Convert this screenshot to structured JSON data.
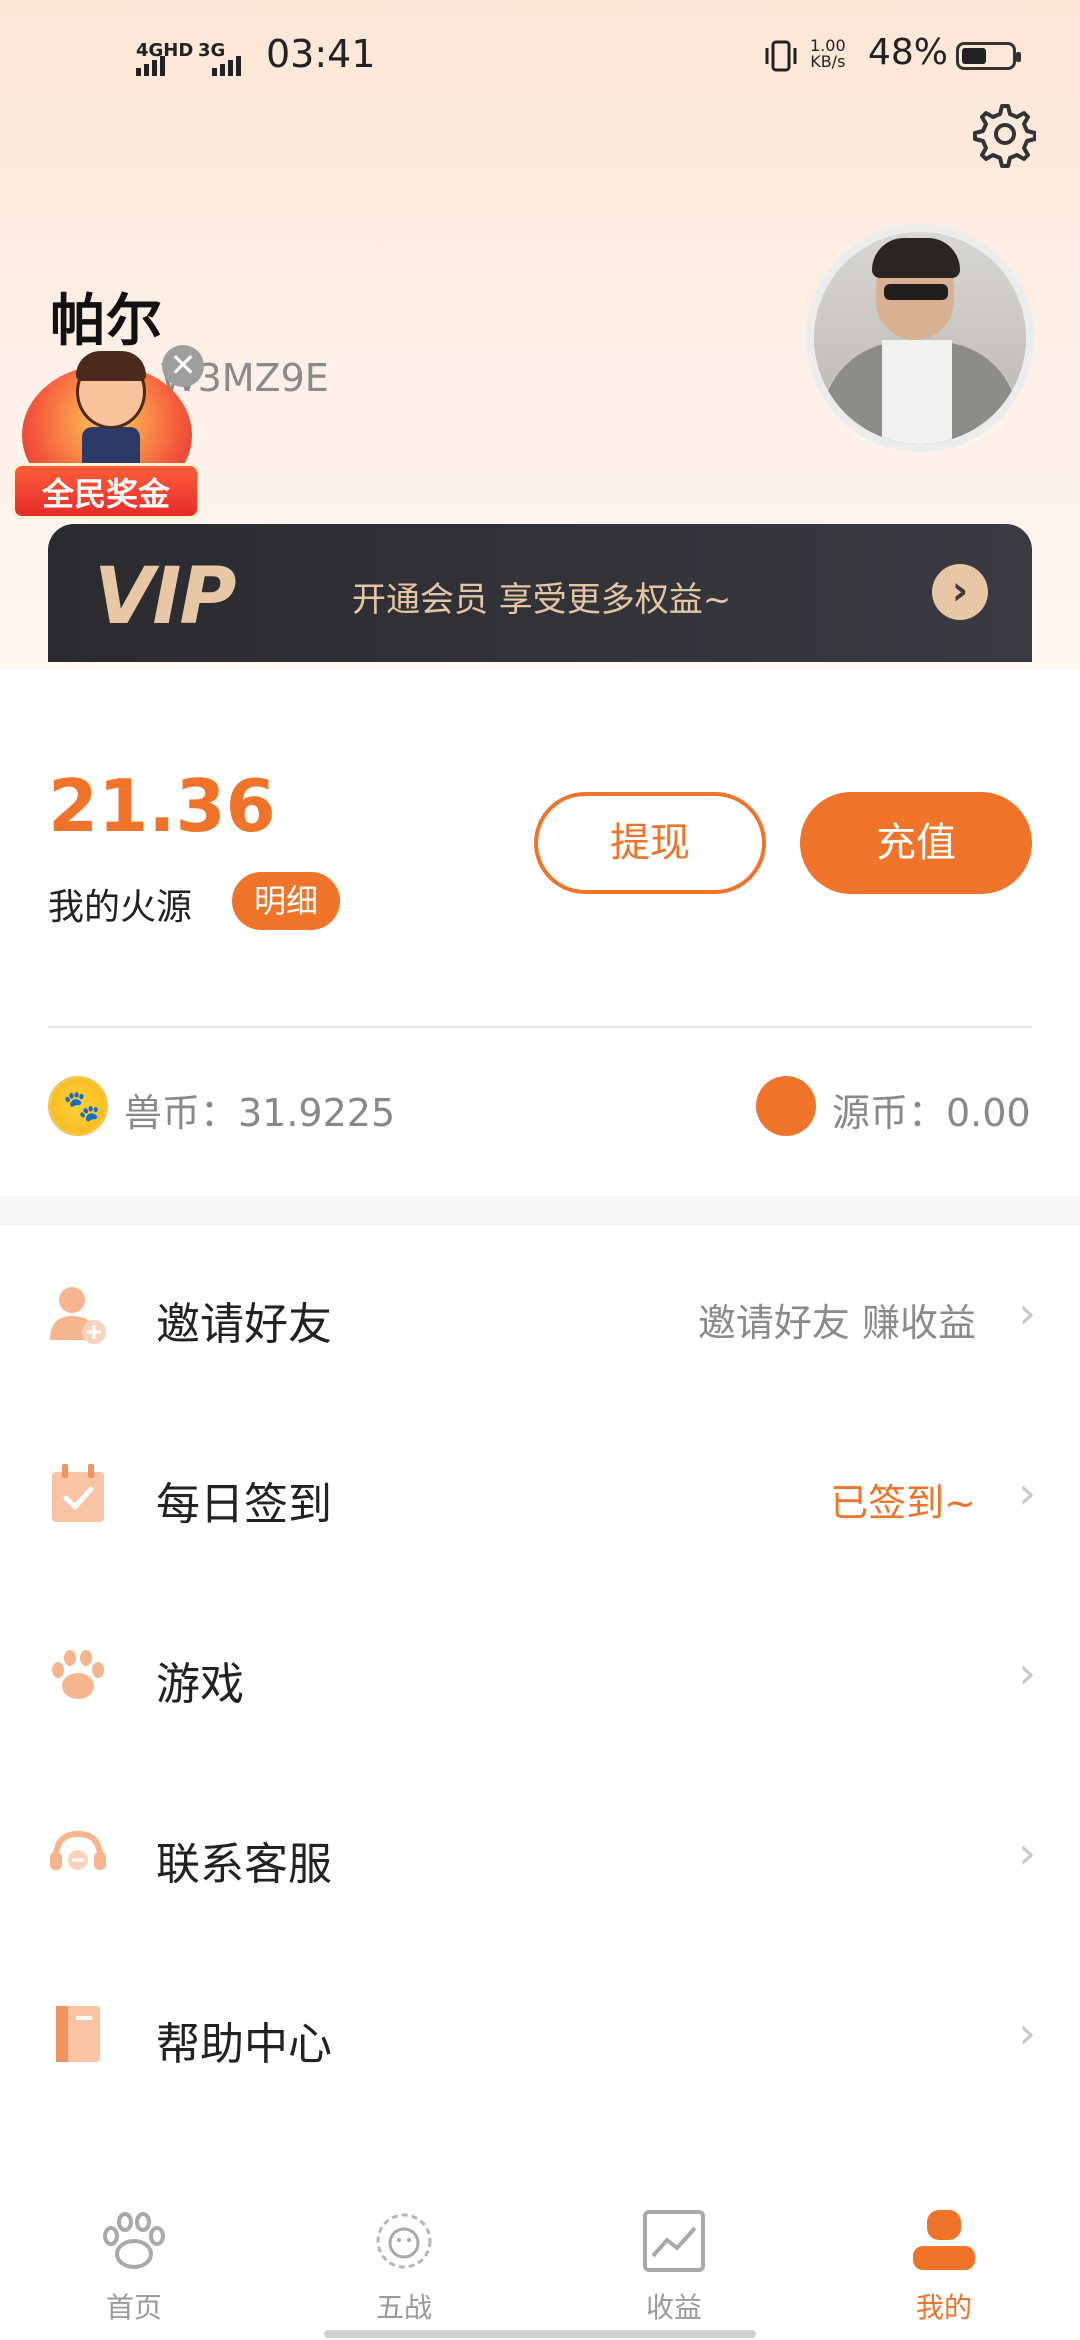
{
  "status_bar": {
    "network1": "4GHD",
    "network2": "3G",
    "time": "03:41",
    "speed_value": "1.00",
    "speed_unit": "KB/s",
    "battery": "48%"
  },
  "profile": {
    "name": "帕尔",
    "invite_code_visible": "W3MZ9E"
  },
  "promo": {
    "label": "全民奖金",
    "close": "✕"
  },
  "vip": {
    "logo": "VIP",
    "text": "开通会员 享受更多权益~",
    "arrow": "›"
  },
  "balance": {
    "value": "21.36",
    "label": "我的火源",
    "detail": "明细",
    "withdraw": "提现",
    "recharge": "充值"
  },
  "coins": {
    "beast_coin": "兽币：31.9225",
    "source_coin": "源币：0.00"
  },
  "menu": [
    {
      "label": "邀请好友",
      "hint": "邀请好友  赚收益",
      "icon": "user-add-icon"
    },
    {
      "label": "每日签到",
      "hint": "已签到~",
      "icon": "calendar-check-icon"
    },
    {
      "label": "游戏",
      "hint": "",
      "icon": "paw-icon"
    },
    {
      "label": "联系客服",
      "hint": "",
      "icon": "headset-icon"
    },
    {
      "label": "帮助中心",
      "hint": "",
      "icon": "book-icon"
    }
  ],
  "tabs": [
    {
      "label": "首页",
      "icon": "paw-icon"
    },
    {
      "label": "五战",
      "icon": "lion-icon"
    },
    {
      "label": "收益",
      "icon": "chart-icon"
    },
    {
      "label": "我的",
      "icon": "person-icon"
    }
  ],
  "colors": {
    "accent": "#f0732a",
    "vip_bg": "#2e2e34",
    "vip_gold": "#e7c7a5"
  }
}
